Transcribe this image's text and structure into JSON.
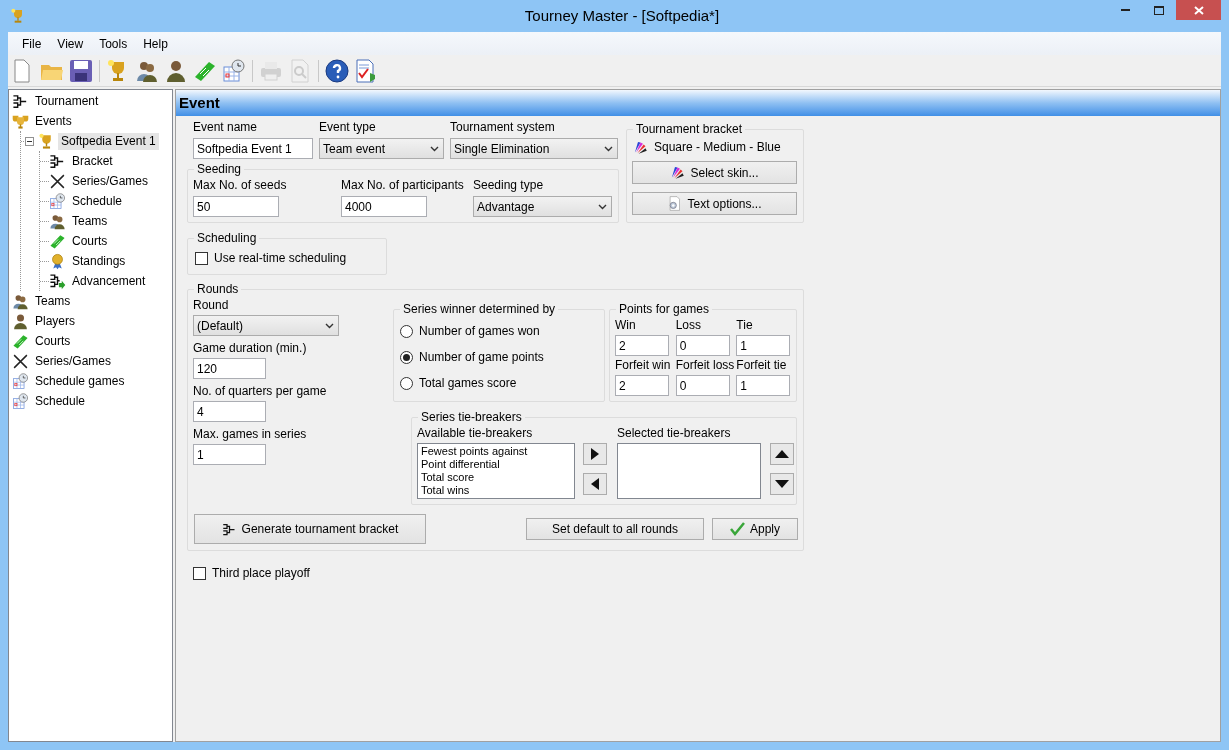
{
  "window": {
    "title": "Tourney Master - [Softpedia*]"
  },
  "menu": [
    "File",
    "View",
    "Tools",
    "Help"
  ],
  "toolbar": [
    {
      "kind": "new",
      "disabled": false
    },
    {
      "kind": "open",
      "disabled": false
    },
    {
      "kind": "save",
      "disabled": false
    },
    {
      "kind": "sep"
    },
    {
      "kind": "trophy",
      "disabled": false
    },
    {
      "kind": "teams",
      "disabled": false
    },
    {
      "kind": "player",
      "disabled": false
    },
    {
      "kind": "court",
      "disabled": false
    },
    {
      "kind": "schedule",
      "disabled": false
    },
    {
      "kind": "sep"
    },
    {
      "kind": "print",
      "disabled": true
    },
    {
      "kind": "preview",
      "disabled": true
    },
    {
      "kind": "sep"
    },
    {
      "kind": "help",
      "disabled": false
    },
    {
      "kind": "check",
      "disabled": false
    }
  ],
  "tree": [
    {
      "label": "Tournament",
      "kind": "bracket",
      "selected": false
    },
    {
      "label": "Events",
      "kind": "trophies",
      "selected": false,
      "children": [
        {
          "label": "Softpedia Event 1",
          "kind": "trophy",
          "selected": true,
          "expanded": true,
          "children": [
            {
              "label": "Bracket",
              "kind": "bracket",
              "selected": false
            },
            {
              "label": "Series/Games",
              "kind": "swords",
              "selected": false
            },
            {
              "label": "Schedule",
              "kind": "schedule",
              "selected": false
            },
            {
              "label": "Teams",
              "kind": "teams",
              "selected": false
            },
            {
              "label": "Courts",
              "kind": "court",
              "selected": false
            },
            {
              "label": "Standings",
              "kind": "medal",
              "selected": false
            },
            {
              "label": "Advancement",
              "kind": "advance",
              "selected": false
            }
          ]
        }
      ]
    },
    {
      "label": "Teams",
      "kind": "teams",
      "selected": false
    },
    {
      "label": "Players",
      "kind": "player",
      "selected": false
    },
    {
      "label": "Courts",
      "kind": "court",
      "selected": false
    },
    {
      "label": "Series/Games",
      "kind": "swords",
      "selected": false
    },
    {
      "label": "Schedule games",
      "kind": "schedule",
      "selected": false
    },
    {
      "label": "Schedule",
      "kind": "schedule",
      "selected": false
    }
  ],
  "panel": {
    "title": "Event",
    "event_name": {
      "label": "Event name",
      "value": "Softpedia Event 1"
    },
    "event_type": {
      "label": "Event type",
      "value": "Team event"
    },
    "tournament_system": {
      "label": "Tournament system",
      "value": "Single Elimination"
    },
    "seeding": {
      "title": "Seeding",
      "max_seeds": {
        "label": "Max No. of seeds",
        "value": "50"
      },
      "max_participants": {
        "label": "Max No. of participants",
        "value": "4000"
      },
      "seeding_type": {
        "label": "Seeding type",
        "value": "Advantage"
      }
    },
    "bracket": {
      "title": "Tournament bracket",
      "skin": "Square - Medium - Blue",
      "buttons": [
        "Select skin...",
        "Text options..."
      ]
    },
    "scheduling": {
      "title": "Scheduling",
      "checkbox": {
        "label": "Use real-time scheduling",
        "checked": false
      }
    },
    "rounds": {
      "title": "Rounds",
      "round": {
        "label": "Round",
        "value": "(Default)"
      },
      "fields": [
        {
          "label": "Game duration (min.)",
          "value": "120"
        },
        {
          "label": "No. of quarters per game",
          "value": "4"
        },
        {
          "label": "Max. games in series",
          "value": "1"
        }
      ],
      "series_winner": {
        "title": "Series winner determined by",
        "options": [
          {
            "label": "Number of games won",
            "selected": false
          },
          {
            "label": "Number of game points",
            "selected": true
          },
          {
            "label": "Total games score",
            "selected": false
          }
        ]
      },
      "points": {
        "title": "Points for games",
        "fields": [
          {
            "label": "Win",
            "value": "2"
          },
          {
            "label": "Loss",
            "value": "0"
          },
          {
            "label": "Tie",
            "value": "1"
          },
          {
            "label": "Forfeit win",
            "value": "2"
          },
          {
            "label": "Forfeit loss",
            "value": "0"
          },
          {
            "label": "Forfeit tie",
            "value": "1"
          }
        ]
      },
      "tie_breakers": {
        "title": "Series tie-breakers",
        "available_label": "Available tie-breakers",
        "available": [
          "Fewest points against",
          "Point differential",
          "Total score",
          "Total wins"
        ],
        "selected_label": "Selected tie-breakers"
      },
      "generate_button": "Generate tournament bracket",
      "default_button": "Set default to all rounds",
      "apply_button": "Apply"
    },
    "third_place": {
      "label": "Third place playoff",
      "checked": false
    }
  }
}
